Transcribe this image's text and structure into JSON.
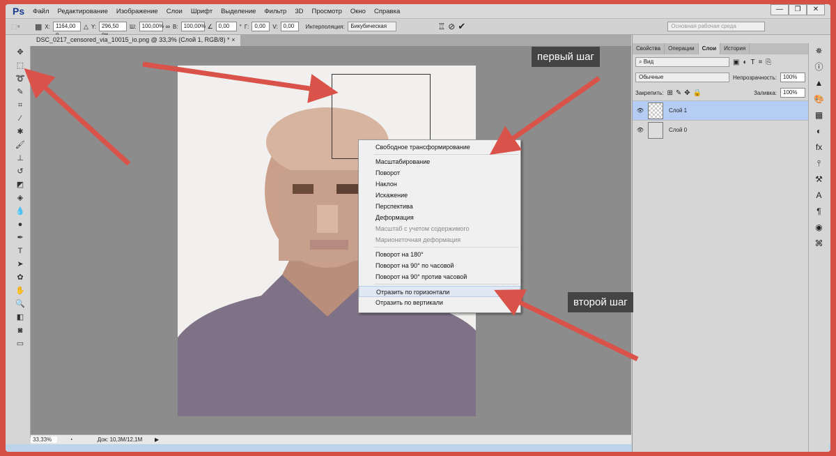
{
  "app": {
    "logo": "Ps",
    "menu": [
      "Файл",
      "Редактирование",
      "Изображение",
      "Слои",
      "Шрифт",
      "Выделение",
      "Фильтр",
      "3D",
      "Просмотр",
      "Окно",
      "Справка"
    ],
    "window_buttons": [
      "—",
      "❐",
      "✕"
    ]
  },
  "options": {
    "x_label": "X:",
    "x": "1164,00 п",
    "y_label": "Y:",
    "y": "296,50 пи",
    "w_label": "Ш:",
    "w": "100,00%",
    "h_label": "В:",
    "h": "100,00%",
    "angle": "0,00",
    "deg": "°",
    "hskew_label": "Г:",
    "hskew": "0,00",
    "vskew_label": "V:",
    "vskew": "0,00",
    "interp_label": "Интерполяция:",
    "interp": "Бикубическая",
    "workspace": "Основная рабочая среда"
  },
  "document": {
    "tab": "DSC_0217_censored_via_10015_io.png @ 33,3% (Слой 1, RGB/8) *",
    "close": "×"
  },
  "status": {
    "zoom": "33,33%",
    "doc": "Док: 10,3M/12,1M"
  },
  "panel": {
    "tabs": [
      "Свойства",
      "Операции",
      "Слои",
      "История"
    ],
    "active_tab": "Слои",
    "filter": "Вид",
    "blend": "Обычные",
    "opacity_label": "Непрозрачность:",
    "opacity": "100%",
    "lock_label": "Закрепить:",
    "fill_label": "Заливка:",
    "fill": "100%",
    "layers": [
      {
        "name": "Слой 1",
        "selected": true
      },
      {
        "name": "Слой 0",
        "selected": false
      }
    ]
  },
  "context_menu": {
    "groups": [
      [
        {
          "label": "Свободное трансформирование"
        }
      ],
      [
        {
          "label": "Масштабирование"
        },
        {
          "label": "Поворот"
        },
        {
          "label": "Наклон"
        },
        {
          "label": "Искажение"
        },
        {
          "label": "Перспектива"
        },
        {
          "label": "Деформация"
        },
        {
          "label": "Масштаб с учетом содержимого",
          "disabled": true
        },
        {
          "label": "Марионеточная деформация",
          "disabled": true
        }
      ],
      [
        {
          "label": "Поворот на 180°"
        },
        {
          "label": "Поворот на 90° по часовой"
        },
        {
          "label": "Поворот на 90° против часовой"
        }
      ],
      [
        {
          "label": "Отразить по горизонтали",
          "highlighted": true
        },
        {
          "label": "Отразить по вертикали"
        }
      ]
    ]
  },
  "annotations": {
    "step1": "первый шаг",
    "step2": "второй шаг",
    "arrow_color": "#d9534a"
  }
}
